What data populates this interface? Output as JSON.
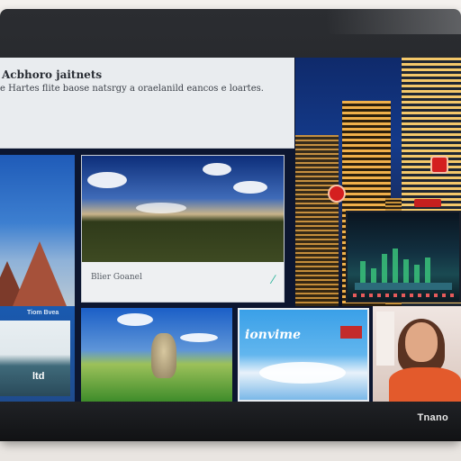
{
  "device": {
    "brand": "Tnano"
  },
  "header": {
    "title": "Acbhoro jaitnets",
    "description": "e Hartes flite baose natsrgy a oraelanild eancos e loartes."
  },
  "tiles": {
    "hills": {
      "caption": "Blier Goanel"
    },
    "coast": {
      "label": "Tiom Bvea",
      "text": "ltd"
    },
    "sky": {
      "text": "ionvime"
    }
  },
  "colors": {
    "accent": "#2bb39a",
    "badge": "#d41f1f",
    "screen_bg": "#0c1630"
  }
}
